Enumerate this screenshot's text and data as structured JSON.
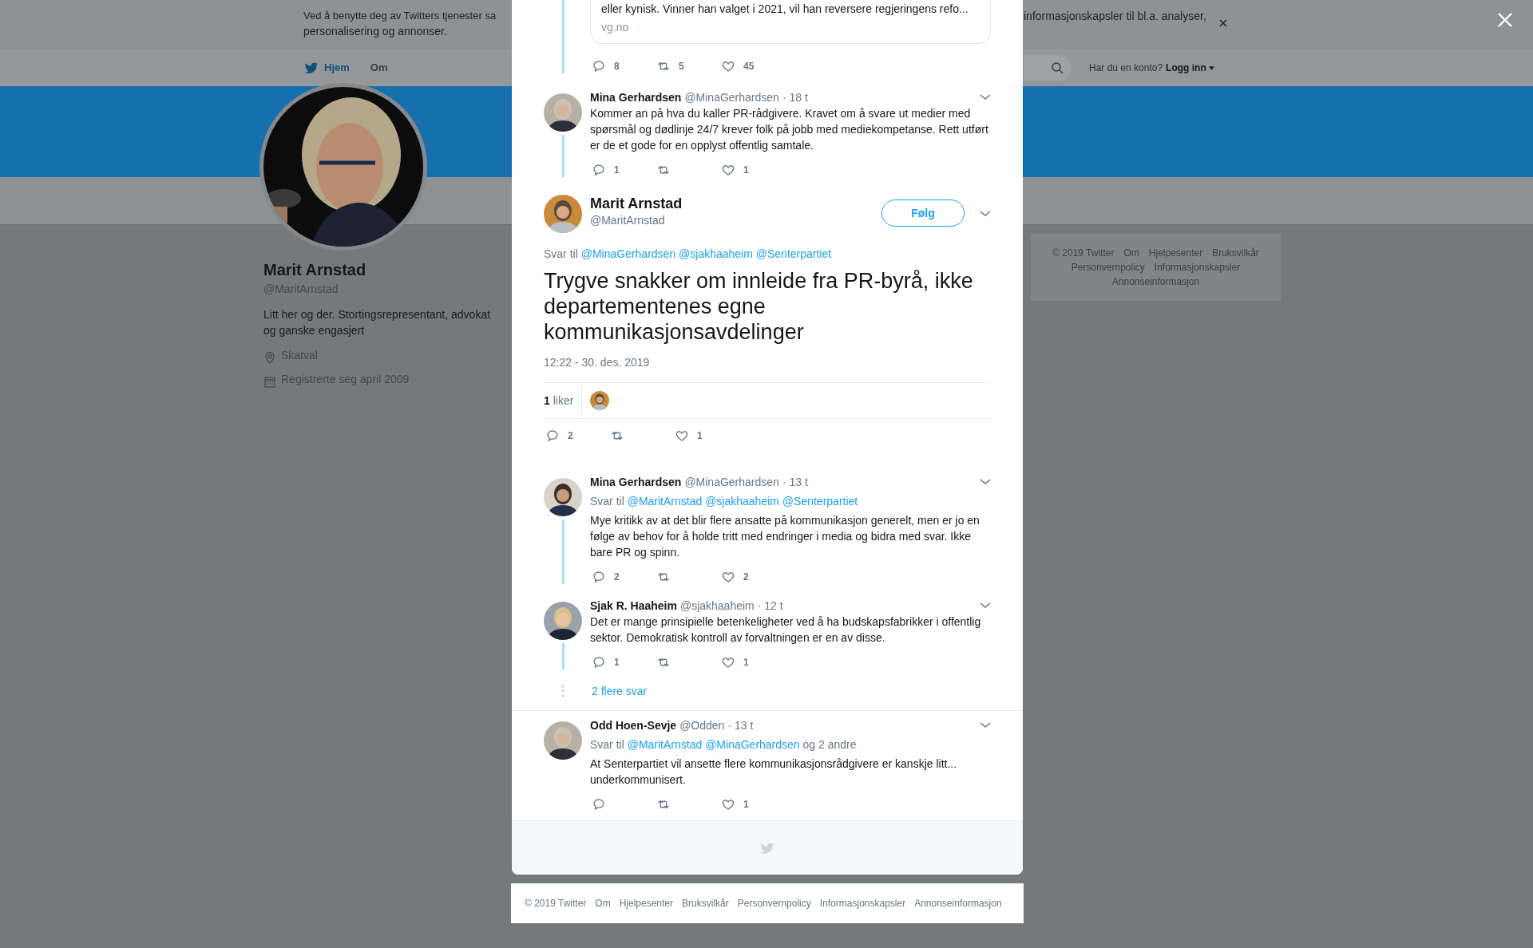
{
  "cookie_banner": {
    "text_left": "Ved å benytte deg av Twitters tjenester sa",
    "text_right": "informasjonskapsler til bl.a. analyser,",
    "text_line2": "personalisering og annonser."
  },
  "nav": {
    "items": [
      {
        "label": "Hjem",
        "selected": true
      },
      {
        "label": "Om",
        "selected": false
      }
    ],
    "account_prompt": "Har du en konto?",
    "login": "Logg inn"
  },
  "profile": {
    "name": "Marit Arnstad",
    "handle": "@MaritArnstad",
    "bio": "Litt her og der. Stortingsrepresentant, advokat og ganske engasjert",
    "location": "Skatval",
    "joined": "Registrerte seg april 2009"
  },
  "side_footer": {
    "links": [
      "© 2019 Twitter",
      "Om",
      "Hjelpesenter",
      "Bruksvilkår",
      "Personvernpolicy",
      "Informasjonskapsler",
      "Annonseinformasjon"
    ]
  },
  "modal": {
    "tweets": [
      {
        "kind": "cut",
        "quote": {
          "text": "eller kynisk. Vinner han valget i 2021, vil han reversere regjeringens refo...",
          "domain": "vg.no"
        },
        "actions": {
          "replies": "8",
          "retweets": "5",
          "likes": "45"
        },
        "connected_below": true
      },
      {
        "kind": "reply",
        "name": "Mina Gerhardsen",
        "handle": "@MinaGerhardsen",
        "time": "· 18 t",
        "divider_above": false,
        "text": "Kommer an på hva du kaller PR-rådgivere. Kravet om å svare ut medier med spørsmål og dødlinje 24/7 krever folk på jobb med mediekompetanse. Rett utført er de et gode for en opplyst offentlig samtale.",
        "actions": {
          "replies": "1",
          "likes": "1"
        },
        "connected_below": true
      },
      {
        "kind": "focused",
        "name": "Marit Arnstad",
        "handle": "@MaritArnstad",
        "follow": "Følg",
        "reply_to": {
          "prefix": "Svar til",
          "mentions": [
            "@MinaGerhardsen",
            "@sjakhaaheim",
            "@Senterpartiet"
          ]
        },
        "text": "Trygve snakker om innleide fra PR-byrå, ikke departementenes egne kommunikasjonsavdelinger",
        "timestamp": "12:22 - 30. des. 2019",
        "likes_text": "**1** liker",
        "actions": {
          "replies": "2",
          "likes": "1"
        },
        "connected_below": false
      },
      {
        "kind": "reply",
        "name": "Mina Gerhardsen",
        "handle": "@MinaGerhardsen",
        "time": "· 13 t",
        "divider_above": false,
        "reply_to": {
          "prefix": "Svar til",
          "mentions": [
            "@MaritArnstad",
            "@sjakhaaheim",
            "@Senterpartiet"
          ]
        },
        "text": "Mye kritikk av at det blir flere ansatte på kommunikasjon generelt, men er jo en følge av behov for å holde tritt med endringer i media og bidra med svar. Ikke bare PR og spinn.",
        "actions": {
          "replies": "2",
          "likes": "2"
        },
        "connected_below": true
      },
      {
        "kind": "reply",
        "name": "Sjak R. Haaheim",
        "handle": "@sjakhaaheim",
        "time": "· 12 t",
        "divider_above": false,
        "text": "Det er mange prinsipielle betenkeligheter ved å ha budskapsfabrikker i offentlig sektor. Demokratisk kontroll av forvaltningen er en av disse.",
        "actions": {
          "replies": "1",
          "likes": "1"
        },
        "connected_below": true,
        "more_replies": "2 flere svar"
      },
      {
        "kind": "reply",
        "name": "Odd Hoen-Sevje",
        "handle": "@Odden",
        "time": "· 13 t",
        "divider_above": true,
        "reply_to": {
          "prefix": "Svar til",
          "mentions": [
            "@MaritArnstad",
            "@MinaGerhardsen"
          ],
          "suffix": "og 2 andre"
        },
        "text": "At Senterpartiet vil ansette flere kommunikasjonsrådgivere er kanskje litt... underkommunisert.",
        "actions": {
          "likes": "1"
        },
        "connected_below": false
      }
    ]
  },
  "footer": {
    "links": [
      "© 2019 Twitter",
      "Om",
      "Hjelpesenter",
      "Bruksvilkår",
      "Personvernpolicy",
      "Informasjonskapsler",
      "Annonseinformasjon"
    ]
  }
}
